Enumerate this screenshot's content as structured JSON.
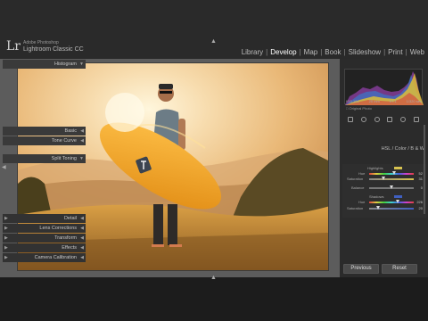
{
  "app": {
    "logo": "Lr",
    "brand_small": "Adobe Photoshop",
    "brand_name": "Lightroom Classic CC"
  },
  "modules": [
    {
      "label": "Library",
      "active": false
    },
    {
      "label": "Develop",
      "active": true
    },
    {
      "label": "Map",
      "active": false
    },
    {
      "label": "Book",
      "active": false
    },
    {
      "label": "Slideshow",
      "active": false
    },
    {
      "label": "Print",
      "active": false
    },
    {
      "label": "Web",
      "active": false
    }
  ],
  "histogram": {
    "title": "Histogram",
    "info": [
      "ISO 100",
      "20 mm",
      "f/7.1",
      "1/320 sec"
    ],
    "original_photo": "Original Photo"
  },
  "panels": {
    "basic": "Basic",
    "tone_curve": "Tone Curve",
    "hsl_tabs": "HSL / Color / B & W",
    "split_toning": "Split Toning",
    "detail": "Detail",
    "lens_corrections": "Lens Corrections",
    "transform": "Transform",
    "effects": "Effects",
    "camera_calibration": "Camera Calibration"
  },
  "split_toning": {
    "highlights_label": "Highlights",
    "highlights_hue_label": "Hue",
    "highlights_hue": "52",
    "highlights_hue_level": 0.55,
    "highlights_sat_label": "Saturation",
    "highlights_sat": "31",
    "highlights_sat_level": 0.31,
    "balance_label": "Balance",
    "balance": "0",
    "balance_level": 0.5,
    "shadows_label": "Shadows",
    "shadows_hue_label": "Hue",
    "shadows_hue": "226",
    "shadows_hue_level": 0.63,
    "shadows_sat_label": "Saturation",
    "shadows_sat": "20",
    "shadows_sat_level": 0.2
  },
  "buttons": {
    "previous": "Previous",
    "reset": "Reset"
  },
  "colors": {
    "highlight_swatch": "#d8c350",
    "shadow_swatch": "#3f5fc0"
  }
}
